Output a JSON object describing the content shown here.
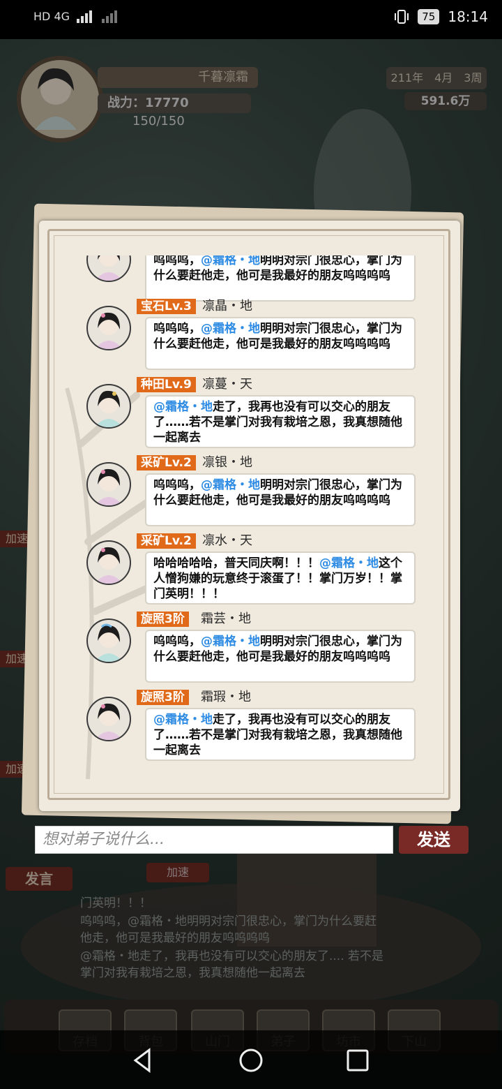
{
  "status_bar": {
    "left": "HD  4G",
    "battery": "75",
    "time": "18:14"
  },
  "hud": {
    "name": "千暮凛霜",
    "power": "战力：17770",
    "stamina": "150/150",
    "date": "211年　4月　3周",
    "money": "591.6万"
  },
  "side_tags": [
    "加速",
    "加速",
    "加速",
    "加速"
  ],
  "under_chat": {
    "speak_label": "发言",
    "accel_label": "加速",
    "lines": [
      "门英明！！！",
      "呜呜呜，@霜格・地明明对宗门很忠心，掌门为什么要赶他走，他可是我最好的朋友呜呜呜呜",
      "@霜格・地走了，我再也没有可以交心的朋友了.... 若不是掌门对我有栽培之恩，我真想随他一起离去"
    ]
  },
  "tabs": [
    "存档",
    "背包",
    "山门",
    "弟子",
    "坊市",
    "下山"
  ],
  "chat": {
    "partial_message": {
      "pre": "呜呜呜，",
      "mention": "@霜格・地",
      "post": "明明对宗门很忠心，掌门为什么要赶他走，他可是我最好的朋友呜呜呜呜"
    },
    "messages": [
      {
        "tag": "宝石Lv.3",
        "name": "凛晶・地",
        "pre": "呜呜呜，",
        "mention": "@霜格・地",
        "post": "明明对宗门很忠心，掌门为什么要赶他走，他可是我最好的朋友呜呜呜呜"
      },
      {
        "tag": "种田Lv.9",
        "name": "凛蔓・天",
        "pre": "",
        "mention": "@霜格・地",
        "post": "走了，我再也没有可以交心的朋友了……若不是掌门对我有栽培之恩，我真想随他一起离去"
      },
      {
        "tag": "采矿Lv.2",
        "name": "凛银・地",
        "pre": "呜呜呜，",
        "mention": "@霜格・地",
        "post": "明明对宗门很忠心，掌门为什么要赶他走，他可是我最好的朋友呜呜呜呜"
      },
      {
        "tag": "采矿Lv.2",
        "name": "凛水・天",
        "pre": "哈哈哈哈哈，普天同庆啊！！！",
        "mention": "@霜格・地",
        "post": "这个人憎狗嫌的玩意终于滚蛋了！！掌门万岁！！掌门英明！！！"
      },
      {
        "tag": "旋照3阶",
        "name": "霜芸・地",
        "pre": "呜呜呜，",
        "mention": "@霜格・地",
        "post": "明明对宗门很忠心，掌门为什么要赶他走，他可是我最好的朋友呜呜呜呜"
      },
      {
        "tag": "旋照3阶",
        "name": "霜瑕・地",
        "pre": "",
        "mention": "@霜格・地",
        "post": "走了，我再也没有可以交心的朋友了……若不是掌门对我有栽培之恩，我真想随他一起离去"
      }
    ]
  },
  "input": {
    "placeholder": "想对弟子说什么..."
  },
  "send_label": "发送"
}
